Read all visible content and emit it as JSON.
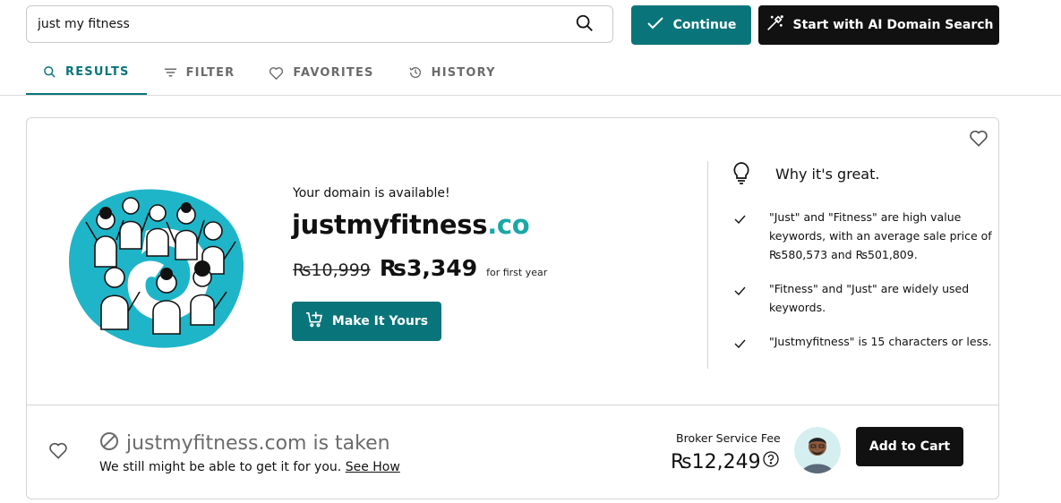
{
  "search": {
    "value": "just my fitness"
  },
  "header": {
    "continue_label": "Continue",
    "ai_search_label": "Start with AI Domain Search"
  },
  "tabs": [
    {
      "label": "RESULTS",
      "icon": "search-icon",
      "active": true
    },
    {
      "label": "FILTER",
      "icon": "filter-icon",
      "active": false
    },
    {
      "label": "FAVORITES",
      "icon": "heart-icon",
      "active": false
    },
    {
      "label": "HISTORY",
      "icon": "history-icon",
      "active": false
    }
  ],
  "featured": {
    "available_text": "Your domain is available!",
    "domain_base": "justmyfitness",
    "domain_tld": ".co",
    "old_price": "₨10,999",
    "new_price": "₨3,349",
    "price_note": "for first year",
    "cta_label": "Make It Yours"
  },
  "why_great": {
    "title": "Why it's great.",
    "items": [
      "\"Just\" and \"Fitness\" are high value keywords, with an average sale price of ₨580,573 and ₨501,809.",
      "\"Fitness\" and \"Just\" are widely used keywords.",
      "\"Justmyfitness\" is 15 characters or less."
    ]
  },
  "taken": {
    "title": "justmyfitness.com is taken",
    "subtitle": "We still might be able to get it for you.",
    "link_label": "See How",
    "broker_label": "Broker Service Fee",
    "broker_price": "₨12,249",
    "add_to_cart_label": "Add to Cart"
  },
  "colors": {
    "primary_teal": "#09757a",
    "tld_teal": "#1aa7a8",
    "illustration_teal": "#1fb5c8",
    "dark_button": "#111111"
  }
}
